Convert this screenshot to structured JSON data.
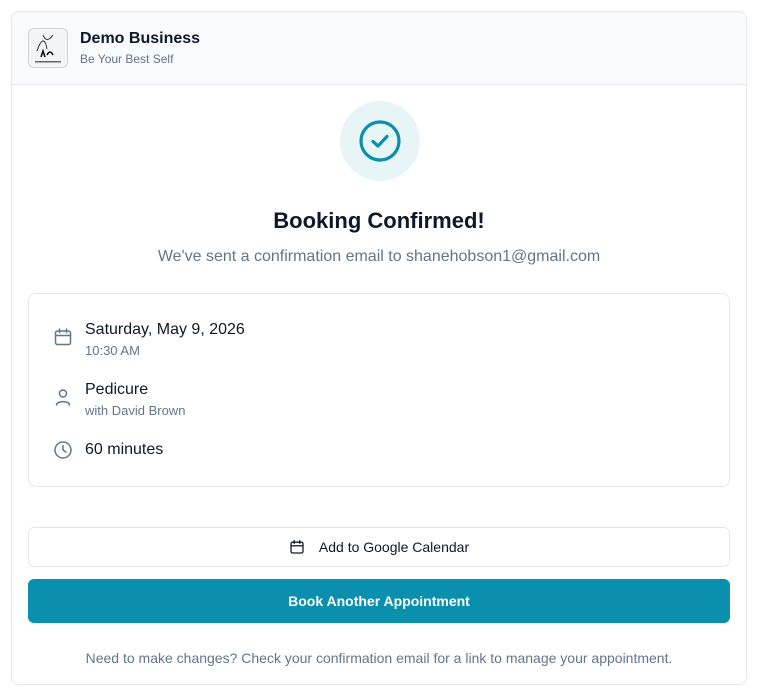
{
  "header": {
    "business_name": "Demo Business",
    "tagline": "Be Your Best Self",
    "logo_icon": "business-logo"
  },
  "confirmation": {
    "icon": "check-circle-icon",
    "title": "Booking Confirmed!",
    "message": "We've sent a confirmation email to shanehobson1@gmail.com"
  },
  "details": {
    "date": "Saturday, May 9, 2026",
    "time": "10:30 AM",
    "service": "Pedicure",
    "staff": "with David Brown",
    "duration": "60 minutes"
  },
  "actions": {
    "calendar_label": "Add to Google Calendar",
    "book_another_label": "Book Another Appointment"
  },
  "footer": {
    "note": "Need to make changes? Check your confirmation email for a link to manage your appointment."
  },
  "colors": {
    "accent": "#0a8fad",
    "accent_soft": "#e8f5f7",
    "muted_text": "#64748b",
    "border": "#e5e7eb"
  }
}
